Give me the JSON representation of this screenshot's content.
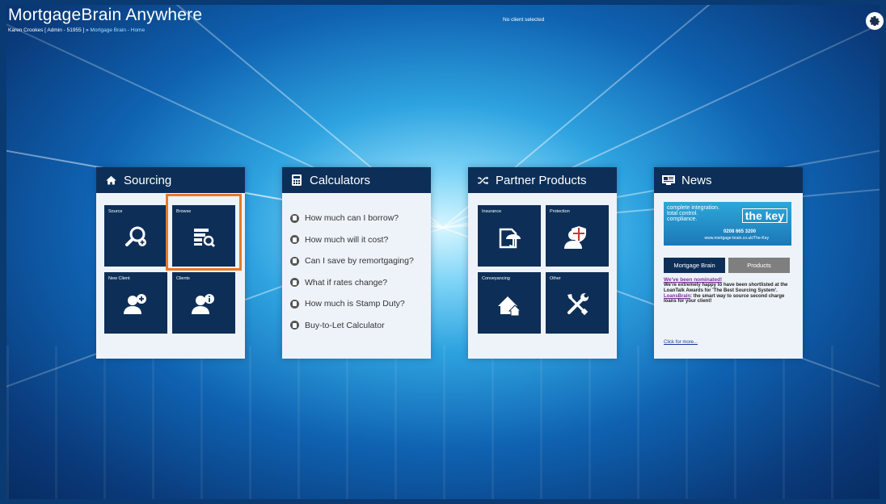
{
  "header": {
    "app_title": "MortgageBrain Anywhere",
    "user_info": "Karen Crookes [ Admin - 51955 ] » ",
    "breadcrumb_link": "Mortgage Brain - Home",
    "client_status": "No client selected"
  },
  "panels": {
    "sourcing": {
      "title": "Sourcing",
      "tiles": [
        {
          "label": "Source"
        },
        {
          "label": "Browse"
        },
        {
          "label": "New Client"
        },
        {
          "label": "Clients"
        }
      ]
    },
    "calculators": {
      "title": "Calculators",
      "items": [
        "How much can I borrow?",
        "How much will it cost?",
        "Can I save by remortgaging?",
        "What if rates change?",
        "How much is Stamp Duty?",
        "Buy-to-Let Calculator"
      ]
    },
    "partner": {
      "title": "Partner Products",
      "tiles": [
        {
          "label": "Insurance"
        },
        {
          "label": "Protection"
        },
        {
          "label": "Conveyancing"
        },
        {
          "label": "Other"
        }
      ]
    },
    "news": {
      "title": "News",
      "banner_line1": "complete integration.",
      "banner_line2": "total control.",
      "banner_line3": "compliance.",
      "banner_brand": "the key",
      "banner_phone": "0208 665 3200",
      "banner_url": "www.mortgage-brain.co.uk/The-Key",
      "tab_active": "Mortgage Brain",
      "tab_inactive": "Products",
      "heading": "We've been nominated!",
      "body_pre": "We're extremely happy to have been shortlisted at the LoanTalk Awards for 'The Best Sourcing System'. ",
      "body_brand": "LoansBrain",
      "body_post": ": the smart way to source second charge loans for your client!",
      "more_link": "Click for more..."
    }
  },
  "colors": {
    "tile": "#0d2f57",
    "highlight": "#e8782a",
    "tab_active": "#0d2f57",
    "tab_inactive": "#7f7f7f"
  }
}
